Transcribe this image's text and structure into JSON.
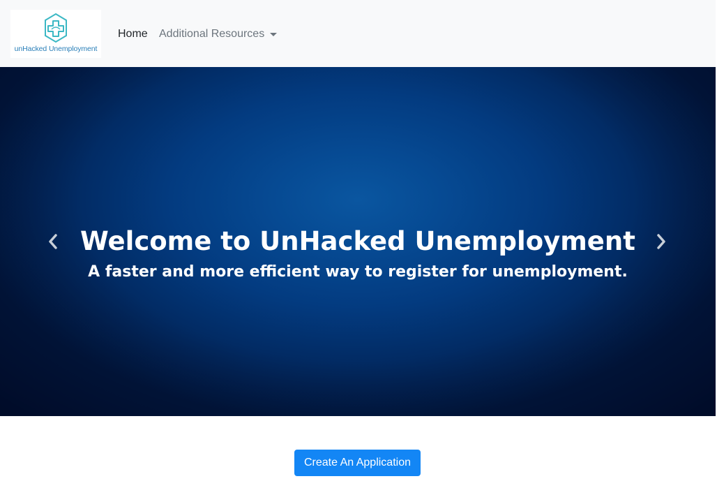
{
  "brand": {
    "text": "unHacked Unemployment",
    "icon": "hexagon-cross-logo-icon",
    "color": "#2a7fb8"
  },
  "nav": {
    "home_label": "Home",
    "resources_label": "Additional Resources"
  },
  "hero": {
    "title": "Welcome to UnHacked Unemployment",
    "subtitle": "A faster and more efficient way to register for unemployment.",
    "prev_icon": "chevron-left-icon",
    "next_icon": "chevron-right-icon"
  },
  "cta": {
    "label": "Create An Application",
    "color": "#1386f5"
  }
}
